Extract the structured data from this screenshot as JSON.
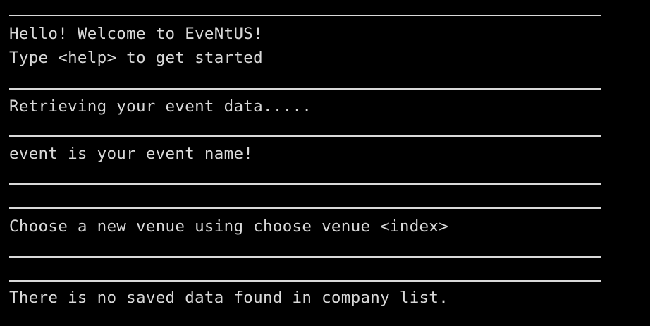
{
  "terminal": {
    "lines": [
      "Hello! Welcome to EveNtUS!",
      "Type <help> to get started",
      "Retrieving your event data.....",
      "event is your event name!",
      "Choose a new venue using choose venue <index>",
      "There is no saved data found in company list."
    ]
  }
}
